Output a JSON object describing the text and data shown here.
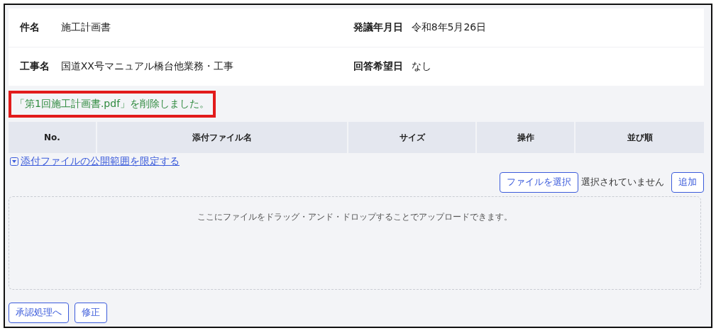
{
  "info": [
    {
      "label": "件名",
      "value": "施工計画書",
      "label_2": "発議年月日",
      "value_2": "令和8年5月26日"
    },
    {
      "label": "工事名",
      "value": "国道XX号マニュアル橋台他業務・工事",
      "label_2": "回答希望日",
      "value_2": "なし"
    }
  ],
  "message": {
    "text": "「第1回施工計画書.pdf」を削除しました。",
    "highlighted": true
  },
  "table": {
    "columns": [
      "No.",
      "添付ファイル名",
      "サイズ",
      "操作",
      "並び順"
    ]
  },
  "scope_link": {
    "text": "添付ファイルの公開範囲を限定する",
    "expanded": false
  },
  "file_picker": {
    "button": "ファイルを選択",
    "status": "選択されていません",
    "add_button": "追加"
  },
  "dropzone": {
    "text": "ここにファイルをドラッグ・アンド・ドロップすることでアップロードできます。"
  },
  "buttons": [
    "承認処理へ",
    "修正"
  ]
}
